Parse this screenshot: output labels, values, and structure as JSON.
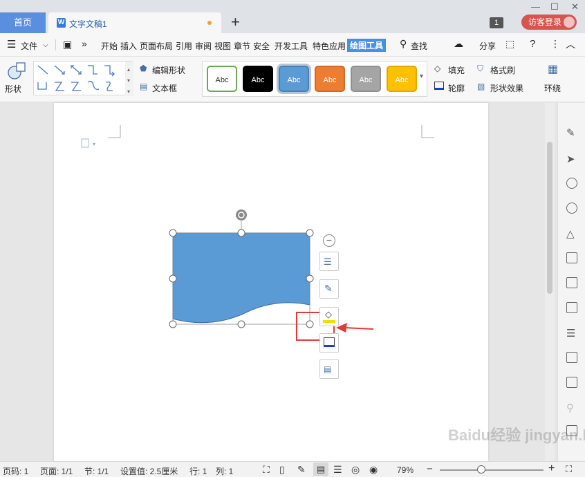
{
  "tabs": {
    "home": "首页",
    "doc_name": "文字文稿1",
    "add": "+"
  },
  "window": {
    "badge": "1",
    "guest_login": "访客登录"
  },
  "menu": {
    "file": "文件",
    "items": [
      "开始",
      "插入",
      "页面布局",
      "引用",
      "审阅",
      "视图",
      "章节",
      "安全",
      "开发工具",
      "特色应用"
    ],
    "active": "绘图工具",
    "search": "查找",
    "share": "分享"
  },
  "ribbon": {
    "shape": "形状",
    "edit_shape": "编辑形状",
    "textbox": "文本框",
    "style_label": "Abc",
    "fill": "填充",
    "outline": "轮廓",
    "format_painter": "格式刷",
    "shape_effects": "形状效果",
    "wrap": "环绕"
  },
  "styles": [
    {
      "bg": "#ffffff",
      "fg": "#333333",
      "border": "#6aa84f"
    },
    {
      "bg": "#000000",
      "fg": "#ffffff",
      "border": "#000000"
    },
    {
      "bg": "#5b9bd5",
      "fg": "#ffffff",
      "border": "#4a80b4"
    },
    {
      "bg": "#ed7d31",
      "fg": "#ffffff",
      "border": "#d06a25"
    },
    {
      "bg": "#a5a5a5",
      "fg": "#ffffff",
      "border": "#909090"
    },
    {
      "bg": "#ffc000",
      "fg": "#ffffff",
      "border": "#e0a800"
    }
  ],
  "colors": {
    "shape_fill": "#5b9bd5",
    "highlight": "#e53935",
    "accent": "#4a90e2"
  },
  "status": {
    "page_num": "页码: 1",
    "page": "页面: 1/1",
    "section": "节: 1/1",
    "setting": "设置值: 2.5厘米",
    "row": "行: 1",
    "col": "列: 1",
    "zoom": "79%"
  },
  "watermark": "Baidu经验 jingyan.baidu.com"
}
